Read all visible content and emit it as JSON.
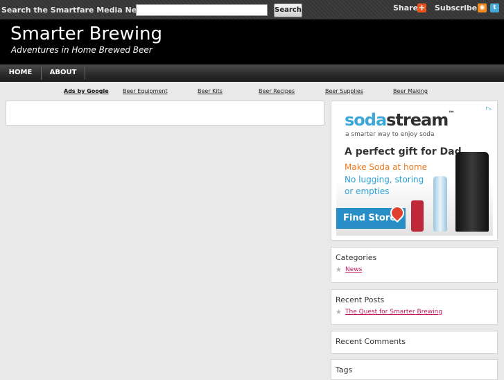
{
  "topbar": {
    "search_label": "Search the Smartfare Media Network:",
    "search_value": "",
    "search_button": "Search",
    "share_label": "Share:",
    "share_icon": "plus-icon",
    "subscribe_label": "Subscribe:",
    "subscribe_icons": [
      "rss-icon",
      "twitter-icon"
    ]
  },
  "header": {
    "title": "Smarter Brewing",
    "tagline": "Adventures in Home Brewed Beer"
  },
  "nav": {
    "items": [
      {
        "label": "HOME"
      },
      {
        "label": "ABOUT"
      }
    ]
  },
  "adlinks": {
    "ads_by": "Ads by Google",
    "links": [
      "Beer Equipment",
      "Beer Kits",
      "Beer Recipes",
      "Beer Supplies",
      "Beer Making"
    ]
  },
  "ad_banner": {
    "brand_part1": "soda",
    "brand_part2": "stream",
    "brand_mark": "™",
    "tagline": "a smarter way to enjoy soda",
    "headline": "A perfect gift for Dad",
    "line1": "Make Soda at home",
    "line2": "No lugging, storing",
    "line3": "or empties",
    "cta": "Find Store"
  },
  "sidebar": {
    "categories": {
      "title": "Categories",
      "items": [
        "News"
      ]
    },
    "recent_posts": {
      "title": "Recent Posts",
      "items": [
        "The Quest for Smarter Brewing"
      ]
    },
    "recent_comments": {
      "title": "Recent Comments"
    },
    "tags": {
      "title": "Tags"
    }
  },
  "colors": {
    "background": "#e9e9e9",
    "header": "#000000",
    "link": "#c2185b",
    "brand_blue": "#2aa0d8",
    "brand_orange": "#f07c1f"
  }
}
